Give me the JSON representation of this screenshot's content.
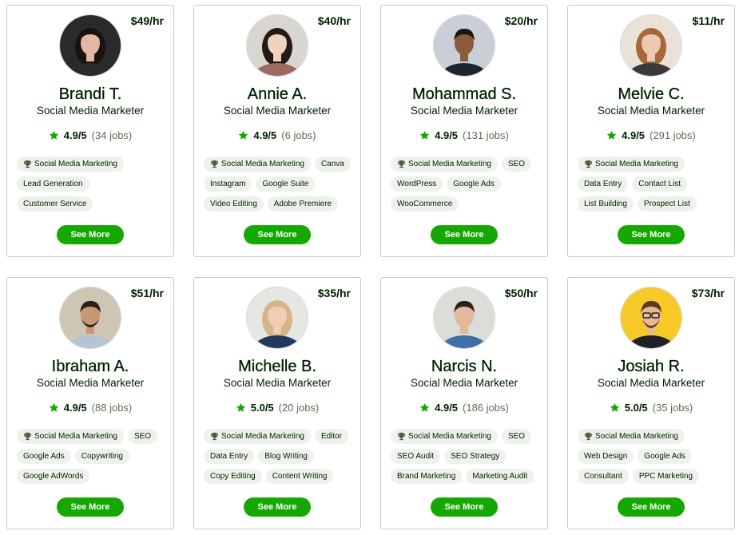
{
  "button_label": "See More",
  "colors": {
    "accent_green": "#14a800",
    "pill_background": "#eff2ec",
    "star_green": "#14a800"
  },
  "icons": {
    "rating": "star-icon",
    "top_skill": "trophy-icon"
  },
  "freelancers": [
    {
      "name": "Brandi T.",
      "title": "Social Media Marketer",
      "rate": "$49/hr",
      "rating": "4.9/5",
      "jobs": "(34 jobs)",
      "avatar_bg": "#2a2a2a",
      "skin": "#e2b8a4",
      "hair": "#1a120e",
      "shirt": "#2b2b2b",
      "skills": [
        "Social Media Marketing",
        "Lead Generation",
        "Customer Service"
      ]
    },
    {
      "name": "Annie A.",
      "title": "Social Media Marketer",
      "rate": "$40/hr",
      "rating": "4.9/5",
      "jobs": "(6 jobs)",
      "avatar_bg": "#d9d6d2",
      "skin": "#efd2bd",
      "hair": "#231a14",
      "shirt": "#9e6a5e",
      "skills": [
        "Social Media Marketing",
        "Canva",
        "Instagram",
        "Google Suite",
        "Video Editing",
        "Adobe Premiere"
      ]
    },
    {
      "name": "Mohammad S.",
      "title": "Social Media Marketer",
      "rate": "$20/hr",
      "rating": "4.9/5",
      "jobs": "(131 jobs)",
      "avatar_bg": "#c9cfd6",
      "skin": "#8a5a3c",
      "hair": "#1b1410",
      "shirt": "#1f2530",
      "skills": [
        "Social Media Marketing",
        "SEO",
        "WordPress",
        "Google Ads",
        "WooCommerce"
      ]
    },
    {
      "name": "Melvie C.",
      "title": "Social Media Marketer",
      "rate": "$11/hr",
      "rating": "4.9/5",
      "jobs": "(291 jobs)",
      "avatar_bg": "#e9e2d7",
      "skin": "#eccab0",
      "hair": "#a8663a",
      "shirt": "#3a3a3a",
      "skills": [
        "Social Media Marketing",
        "Data Entry",
        "Contact List",
        "List Building",
        "Prospect List"
      ]
    },
    {
      "name": "Ibraham A.",
      "title": "Social Media Marketer",
      "rate": "$51/hr",
      "rating": "4.9/5",
      "jobs": "(88 jobs)",
      "avatar_bg": "#cfc5b5",
      "skin": "#c89874",
      "hair": "#2c2019",
      "shirt": "#b4c4d2",
      "skills": [
        "Social Media Marketing",
        "SEO",
        "Google Ads",
        "Copywriting",
        "Google AdWords"
      ]
    },
    {
      "name": "Michelle B.",
      "title": "Social Media Marketer",
      "rate": "$35/hr",
      "rating": "5.0/5",
      "jobs": "(20 jobs)",
      "avatar_bg": "#e6e6e3",
      "skin": "#f0cdb4",
      "hair": "#d4b585",
      "shirt": "#203a5e",
      "skills": [
        "Social Media Marketing",
        "Editor",
        "Data Entry",
        "Blog Writing",
        "Copy Editing",
        "Content Writing"
      ]
    },
    {
      "name": "Narcis N.",
      "title": "Social Media Marketer",
      "rate": "$50/hr",
      "rating": "4.9/5",
      "jobs": "(186 jobs)",
      "avatar_bg": "#dcdcd8",
      "skin": "#e3b89b",
      "hair": "#2c211b",
      "shirt": "#3f6ea8",
      "skills": [
        "Social Media Marketing",
        "SEO",
        "SEO Audit",
        "SEO Strategy",
        "Brand Marketing",
        "Marketing Audit"
      ]
    },
    {
      "name": "Josiah R.",
      "title": "Social Media Marketer",
      "rate": "$73/hr",
      "rating": "5.0/5",
      "jobs": "(35 jobs)",
      "avatar_bg": "#f7c928",
      "skin": "#e6b894",
      "hair": "#5a3b22",
      "shirt": "#1e2228",
      "skills": [
        "Social Media Marketing",
        "Web Design",
        "Google Ads",
        "Consultant",
        "PPC Marketing"
      ]
    }
  ]
}
